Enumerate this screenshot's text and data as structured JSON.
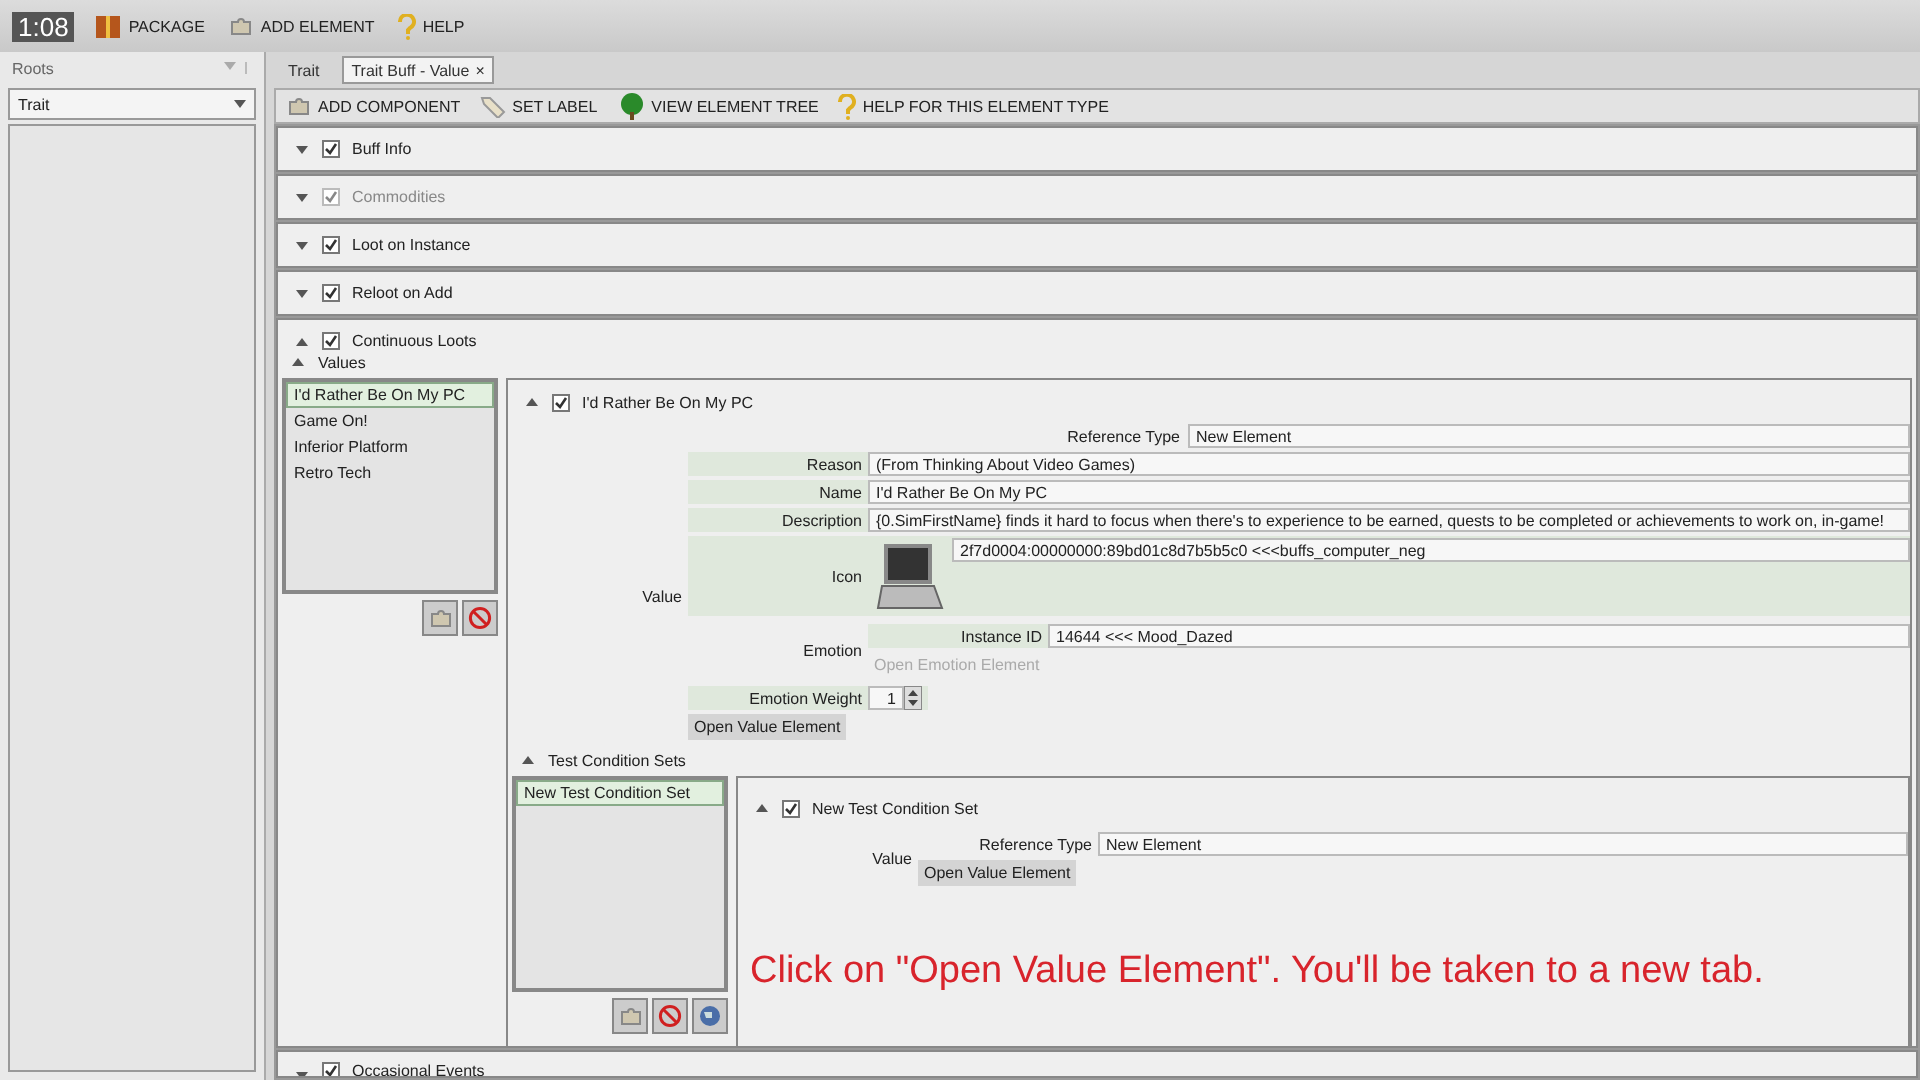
{
  "toolbar": {
    "timestamp": "1:08",
    "items": [
      {
        "kind": "package",
        "label": "PACKAGE"
      },
      {
        "kind": "add",
        "label": "ADD ELEMENT"
      },
      {
        "kind": "help",
        "label": "HELP"
      }
    ]
  },
  "roots_panel": {
    "title": "Roots",
    "dropdown": "Trait"
  },
  "tabs": [
    {
      "label": "Trait",
      "selected": false
    },
    {
      "label": "Trait Buff - Value",
      "selected": true,
      "close": "×"
    }
  ],
  "element_toolbar": [
    {
      "kind": "add",
      "label": "ADD COMPONENT"
    },
    {
      "kind": "label",
      "label": "SET LABEL"
    },
    {
      "kind": "tree",
      "label": "VIEW ELEMENT TREE"
    },
    {
      "kind": "help",
      "label": "HELP FOR THIS ELEMENT TYPE"
    }
  ],
  "sections": [
    {
      "label": "Buff Info",
      "checked": true,
      "disabled": false,
      "expanded": false
    },
    {
      "label": "Commodities",
      "checked": true,
      "disabled": true,
      "expanded": false
    },
    {
      "label": "Loot on Instance",
      "checked": true,
      "disabled": false,
      "expanded": false
    },
    {
      "label": "Reloot on Add",
      "checked": true,
      "disabled": false,
      "expanded": false
    },
    {
      "label": "Continuous Loots",
      "checked": true,
      "disabled": false,
      "expanded": true
    }
  ],
  "continuous_loots": {
    "values_label": "Values",
    "values": [
      {
        "label": "I'd Rather Be On My PC",
        "selected": true
      },
      {
        "label": "Game On!",
        "selected": false
      },
      {
        "label": "Inferior Platform",
        "selected": false
      },
      {
        "label": "Retro Tech",
        "selected": false
      }
    ],
    "detail": {
      "title": "I'd Rather Be On My PC",
      "checked": true,
      "reference_type_label": "Reference Type",
      "reference_type": "New Element",
      "value_label": "Value",
      "fields": [
        {
          "label": "Reason",
          "value": "(From Thinking About Video Games)"
        },
        {
          "label": "Name",
          "value": "I'd Rather Be On My PC"
        },
        {
          "label": "Description",
          "value": "{0.SimFirstName} finds it hard to focus when there's to experience to be earned, quests to be completed or achievements to work on, in-game!"
        }
      ],
      "icon": {
        "label": "Icon",
        "value": "2f7d0004:00000000:89bd01c8d7b5b5c0 <<<buffs_computer_neg"
      },
      "emotion": {
        "label": "Emotion",
        "instance_label": "Instance ID",
        "instance_value": "14644 <<< Mood_Dazed",
        "open_button": {
          "label": "Open Emotion Element",
          "disabled": true
        }
      },
      "emotion_weight": {
        "label": "Emotion Weight",
        "value": "1"
      },
      "open_button": {
        "label": "Open Value Element",
        "disabled": false
      },
      "test_conditions": {
        "label": "Test Condition Sets",
        "items": [
          {
            "label": "New Test Condition Set",
            "selected": true
          }
        ],
        "detail": {
          "title": "New Test Condition Set",
          "checked": true,
          "value_label": "Value",
          "reference_type_label": "Reference Type",
          "reference_type": "New Element",
          "open_button": {
            "label": "Open Value Element",
            "disabled": false
          }
        }
      }
    }
  },
  "trailing_section": {
    "label": "Occasional Events",
    "checked": true,
    "expanded": false
  },
  "caption": "Click on \"Open Value Element\". You'll be taken to a new tab."
}
